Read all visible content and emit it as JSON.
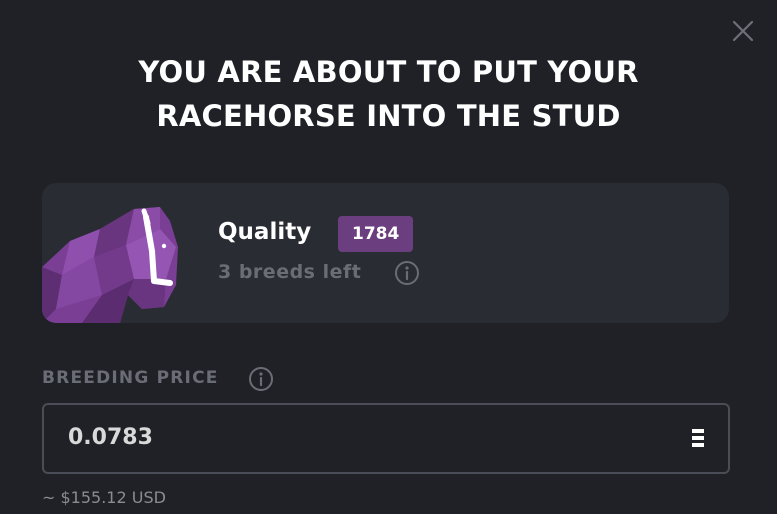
{
  "dialog": {
    "title_line1": "YOU ARE ABOUT TO PUT YOUR",
    "title_line2": "RACEHORSE INTO THE STUD",
    "close_icon": "close-icon"
  },
  "horse": {
    "quality_label": "Quality",
    "quality_value": "1784",
    "breeds_left": "3 breeds left",
    "horse_color": "#7a3f95",
    "badge_color": "#6b3f7f"
  },
  "breeding_price": {
    "label": "BREEDING PRICE",
    "value": "0.0783",
    "currency_icon": "ethereum-icon",
    "usd_estimate": "~ $155.12 USD"
  }
}
